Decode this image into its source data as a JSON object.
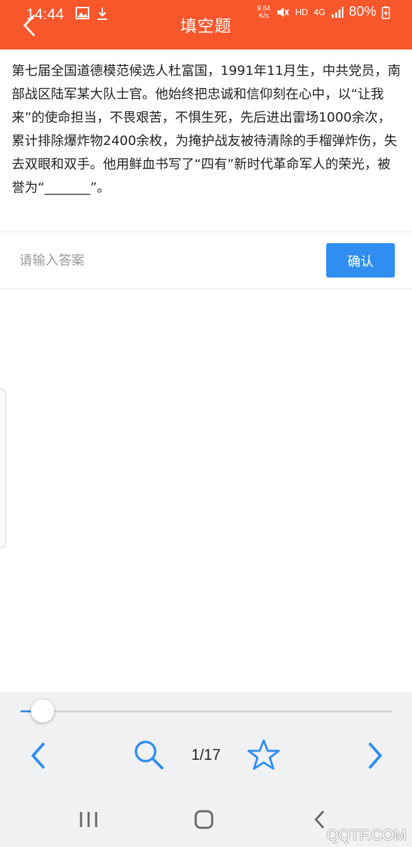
{
  "status_bar": {
    "time": "14:44",
    "net_speed_value": "9.64",
    "net_speed_unit": "K/s",
    "hd": "HD",
    "network": "4G",
    "battery": "80%"
  },
  "header": {
    "title": "填空题",
    "background": "#f8562b"
  },
  "question": {
    "text": "第七届全国道德模范候选人杜富国，1991年11月生，中共党员，南部战区陆军某大队士官。他始终把忠诚和信仰刻在心中，以“让我来”的使命担当，不畏艰苦，不惧生死，先后进出雷场1000余次，累计排除爆炸物2400余枚，为掩护战友被待清除的手榴弹炸伤，失去双眼和双手。他用鲜血书写了“四有”新时代革命军人的荣光，被誉为“_______”。"
  },
  "answer": {
    "value": "",
    "placeholder": "请输入答案",
    "confirm_label": "确认",
    "accent": "#2f8ef0"
  },
  "footer": {
    "progress": 0.06,
    "page_indicator": "1/17",
    "icons": [
      "chevron-left-icon",
      "search-icon",
      "star-icon",
      "chevron-right-icon"
    ]
  },
  "system_nav": {
    "icons": [
      "recent-apps-icon",
      "home-icon",
      "back-icon"
    ]
  },
  "watermark": "QQTF.COM"
}
